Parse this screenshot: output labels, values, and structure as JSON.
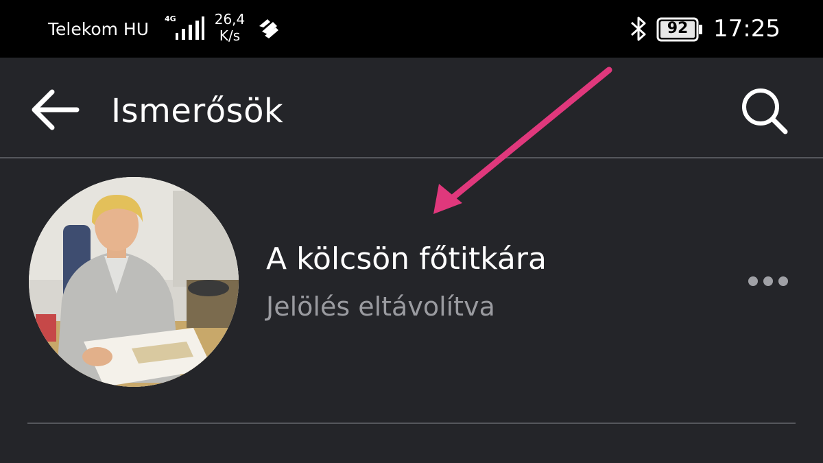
{
  "status_bar": {
    "carrier": "Telekom HU",
    "network_type": "4G",
    "signal_bars": 4,
    "speed_value": "26,4",
    "speed_unit": "K/s",
    "battery_percent": "92",
    "time": "17:25",
    "icons": [
      "signal-icon",
      "huawei-share-icon",
      "bluetooth-icon",
      "battery-icon"
    ]
  },
  "app_bar": {
    "title": "Ismerősök",
    "back_icon": "back-arrow-icon",
    "search_icon": "search-icon"
  },
  "contacts": [
    {
      "name": "A kölcsön főtitkára",
      "status": "Jelölés eltávolítva",
      "avatar": "avatar-photo",
      "more_icon": "more-dots-icon"
    }
  ],
  "annotation": {
    "type": "arrow",
    "color": "#e0387c",
    "points_to": "contact-name"
  },
  "colors": {
    "background": "#242529",
    "status_bar": "#000000",
    "divider": "#55575c",
    "secondary_text": "#9a9ba0",
    "accent_arrow": "#e0387c"
  }
}
